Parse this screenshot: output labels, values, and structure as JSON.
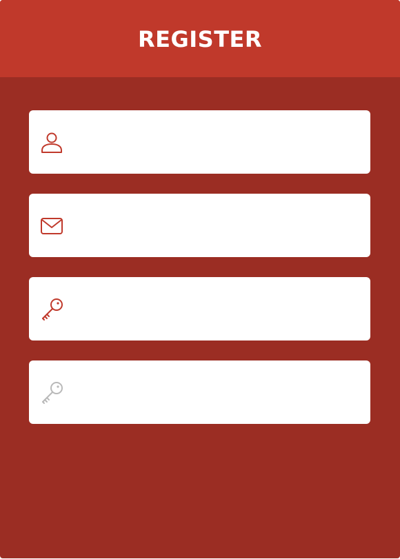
{
  "header": {
    "title": "REGISTER"
  },
  "fields": [
    {
      "name": "username",
      "icon": "user-icon",
      "value": "",
      "placeholder": ""
    },
    {
      "name": "email",
      "icon": "envelope-icon",
      "value": "",
      "placeholder": ""
    },
    {
      "name": "password",
      "icon": "key-icon",
      "value": "",
      "placeholder": ""
    },
    {
      "name": "confirm-password",
      "icon": "key-icon",
      "value": "",
      "placeholder": ""
    }
  ],
  "colors": {
    "header_bg": "#c0392b",
    "body_bg": "#9b2d23",
    "field_bg": "#ffffff",
    "icon_active": "#c0392b",
    "icon_inactive": "#b9b9b9",
    "title_text": "#ffffff"
  }
}
